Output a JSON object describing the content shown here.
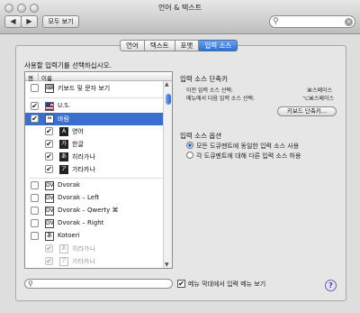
{
  "window": {
    "title": "언어 & 텍스트"
  },
  "toolbar": {
    "back_label": "◀",
    "forward_label": "▶",
    "show_all_label": "모두 보기",
    "search_placeholder": ""
  },
  "tabs": [
    {
      "label": "언어",
      "active": false
    },
    {
      "label": "텍스트",
      "active": false
    },
    {
      "label": "포맷",
      "active": false
    },
    {
      "label": "입력 소스",
      "active": true
    }
  ],
  "input_sources": {
    "instruction": "사용할 입력기를 선택하십시오.",
    "headers": {
      "on": "켬",
      "name": "이름"
    },
    "rows": [
      {
        "label": "키보드 및 문자 보기",
        "checked": false,
        "indent": false,
        "icon": "keyboard-viewer-icon",
        "icon_glyph": "⌨",
        "dim": false
      },
      {
        "label": "U.S.",
        "checked": true,
        "indent": false,
        "icon": "us-flag-icon",
        "icon_glyph": "",
        "dim": false
      },
      {
        "label": "바람",
        "checked": true,
        "indent": false,
        "icon": "baram-icon",
        "icon_glyph": "ㅂ",
        "dim": false,
        "selected": true
      },
      {
        "label": "영어",
        "checked": true,
        "indent": true,
        "icon": "english-mode-icon",
        "icon_glyph": "A",
        "dim": false
      },
      {
        "label": "한글",
        "checked": true,
        "indent": true,
        "icon": "hangul-mode-icon",
        "icon_glyph": "가",
        "dim": false
      },
      {
        "label": "히라가나",
        "checked": true,
        "indent": true,
        "icon": "hiragana-mode-icon",
        "icon_glyph": "あ",
        "dim": false
      },
      {
        "label": "가타카나",
        "checked": true,
        "indent": true,
        "icon": "katakana-mode-icon",
        "icon_glyph": "ア",
        "dim": false
      },
      {
        "label": "Dvorak",
        "checked": false,
        "indent": false,
        "icon": "dvorak-icon",
        "icon_glyph": "DV",
        "dim": false
      },
      {
        "label": "Dvorak – Left",
        "checked": false,
        "indent": false,
        "icon": "dvorak-left-icon",
        "icon_glyph": "DV",
        "dim": false
      },
      {
        "label": "Dvorak – Qwerty ⌘",
        "checked": false,
        "indent": false,
        "icon": "dvorak-qwerty-icon",
        "icon_glyph": "DV",
        "dim": false
      },
      {
        "label": "Dvorak – Right",
        "checked": false,
        "indent": false,
        "icon": "dvorak-right-icon",
        "icon_glyph": "DV",
        "dim": false
      },
      {
        "label": "Kotoeri",
        "checked": false,
        "indent": false,
        "icon": "kotoeri-icon",
        "icon_glyph": "あ",
        "dim": false
      },
      {
        "label": "히라가나",
        "checked": true,
        "indent": true,
        "icon": "kotoeri-hiragana-icon",
        "icon_glyph": "あ",
        "dim": true
      },
      {
        "label": "가타카나",
        "checked": true,
        "indent": true,
        "icon": "kotoeri-katakana-icon",
        "icon_glyph": "ア",
        "dim": true
      }
    ],
    "filter_placeholder": ""
  },
  "shortcuts": {
    "title": "입력 소스 단축키",
    "prev_label": "이전 입력 소스 선택:",
    "prev_value": "⌘스페이스",
    "next_label": "메뉴에서 다음 입력 소스 선택:",
    "next_value": "⌥⌘스페이스",
    "keyboard_shortcuts_button": "키보드 단축키..."
  },
  "options": {
    "title": "입력 소스 옵션",
    "radio_all": "모든 도큐멘트에 동일한 입력 소스 사용",
    "radio_each": "각 도큐멘트에 대해 다른 입력 소스 허용",
    "selected": "all"
  },
  "footer": {
    "show_menu_label": "메뉴 막대에서 입력 메뉴 보기",
    "show_menu_checked": true,
    "help_label": "?"
  }
}
